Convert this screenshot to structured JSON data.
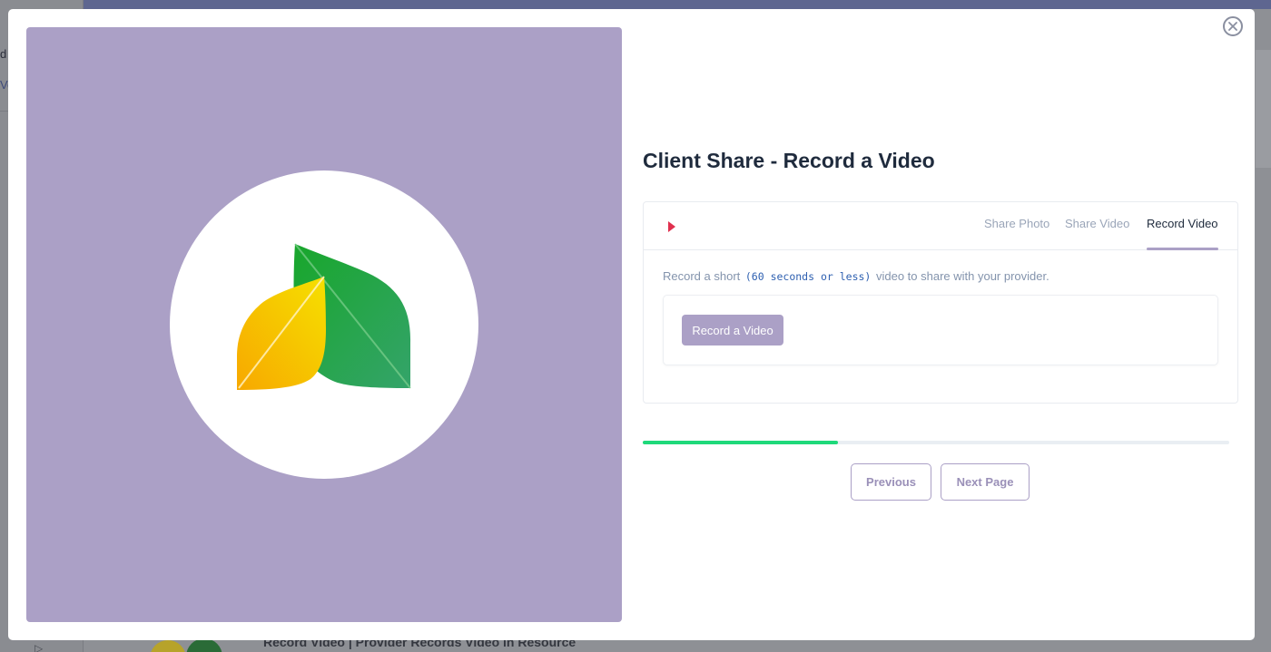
{
  "background": {
    "sidebar_fragment_1": "d",
    "sidebar_fragment_2": "Vo",
    "bottom_text": "Record Video | Provider Records Video in Resource"
  },
  "modal": {
    "title": "Client Share - Record a Video",
    "close_icon": "close-circle-icon",
    "media_panel_color": "#aba0c6",
    "logo": "leaf-logo"
  },
  "card": {
    "tabs": [
      {
        "label": "Share Photo",
        "active": false
      },
      {
        "label": "Share Video",
        "active": false
      },
      {
        "label": "Record Video",
        "active": true
      }
    ],
    "instruction_prefix": "Record a short ",
    "instruction_code": "(60 seconds or less)",
    "instruction_suffix": " video to share with your provider.",
    "record_button_label": "Record a Video"
  },
  "progress": {
    "fraction": 0.333
  },
  "navigation": {
    "previous_label": "Previous",
    "next_label": "Next Page"
  },
  "colors": {
    "accent": "#aba0c6",
    "progress": "#1ed97a",
    "play_icon": "#e0304e"
  }
}
